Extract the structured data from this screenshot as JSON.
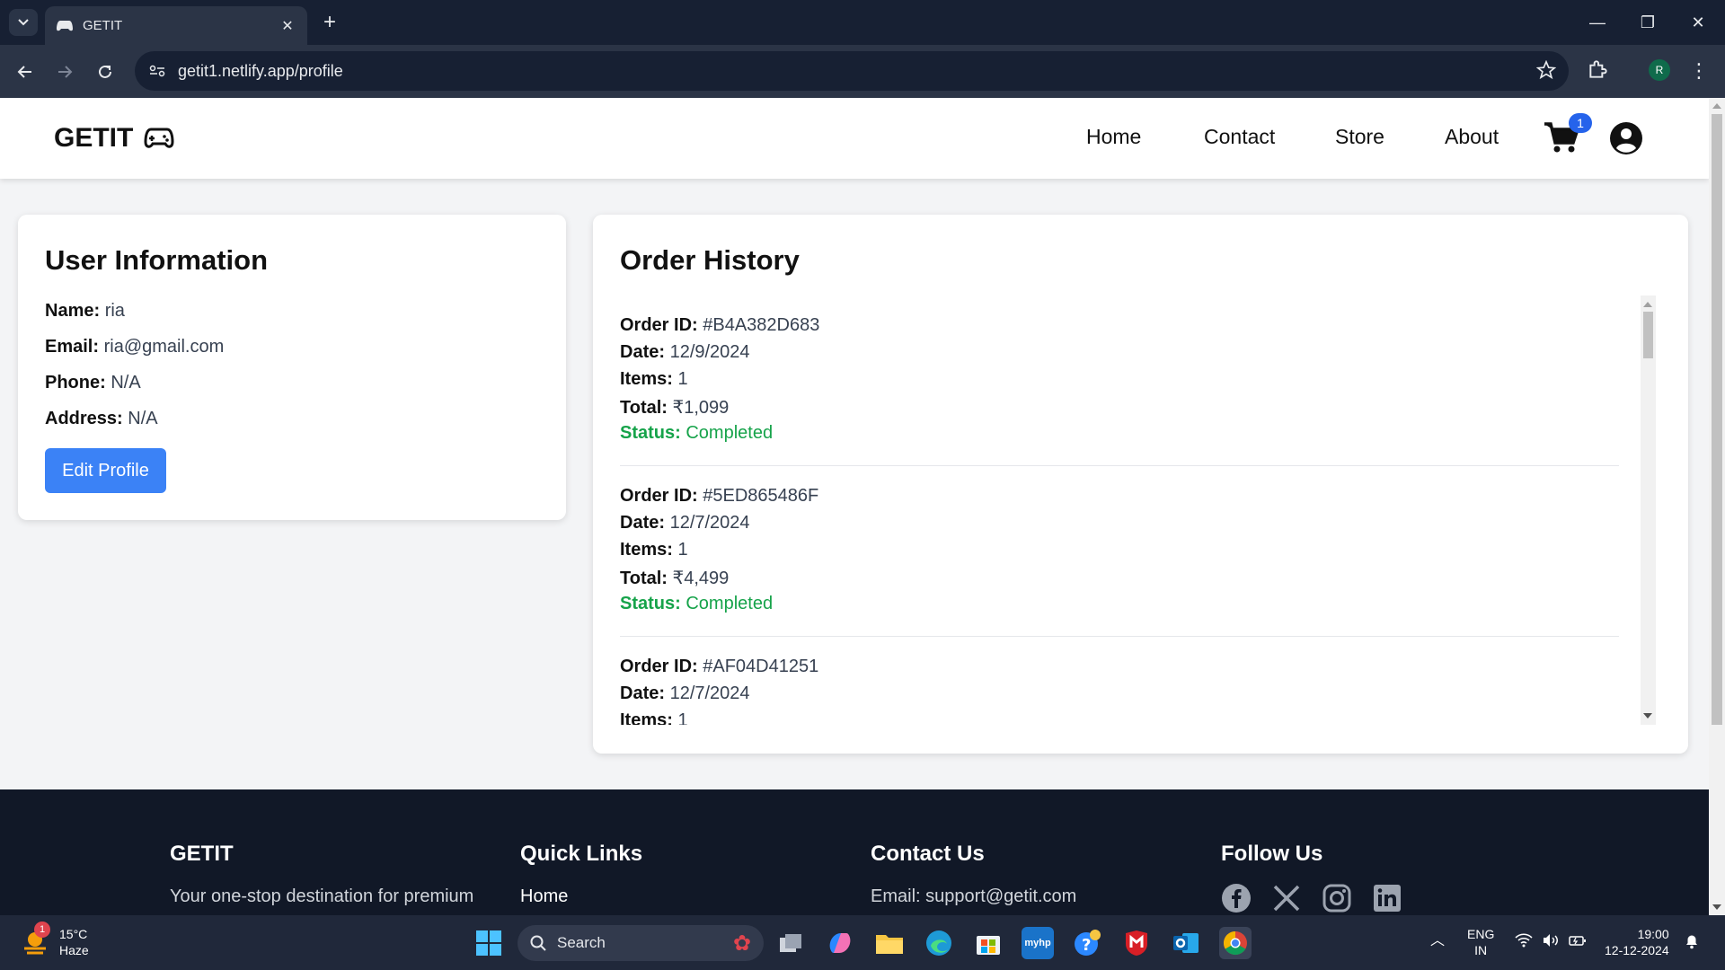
{
  "browser": {
    "tab_title": "GETIT",
    "url": "getit1.netlify.app/profile",
    "profile_initial": "R"
  },
  "site": {
    "brand": "GETIT",
    "nav": [
      "Home",
      "Contact",
      "Store",
      "About"
    ],
    "cart_count": "1"
  },
  "user_info": {
    "heading": "User Information",
    "fields": [
      {
        "label": "Name:",
        "value": "ria"
      },
      {
        "label": "Email:",
        "value": "ria@gmail.com"
      },
      {
        "label": "Phone:",
        "value": "N/A"
      },
      {
        "label": "Address:",
        "value": "N/A"
      }
    ],
    "edit_label": "Edit Profile"
  },
  "orders": {
    "heading": "Order History",
    "labels": {
      "id": "Order ID:",
      "date": "Date:",
      "items": "Items:",
      "total": "Total:",
      "status": "Status:"
    },
    "list": [
      {
        "id": "#B4A382D683",
        "date": "12/9/2024",
        "items": "1",
        "total": "₹1,099",
        "status": "Completed"
      },
      {
        "id": "#5ED865486F",
        "date": "12/7/2024",
        "items": "1",
        "total": "₹4,499",
        "status": "Completed"
      },
      {
        "id": "#AF04D41251",
        "date": "12/7/2024",
        "items": "1",
        "total": "",
        "status": ""
      }
    ]
  },
  "footer": {
    "brand": "GETIT",
    "tagline": "Your one-stop destination for premium",
    "quick_links_heading": "Quick Links",
    "quick_links": [
      "Home"
    ],
    "contact_heading": "Contact Us",
    "contact_email": "Email: support@getit.com",
    "follow_heading": "Follow Us",
    "socials": [
      "facebook-icon",
      "x-icon",
      "instagram-icon",
      "linkedin-icon"
    ]
  },
  "taskbar": {
    "weather_temp": "15°C",
    "weather_desc": "Haze",
    "weather_badge": "1",
    "search_label": "Search",
    "lang_top": "ENG",
    "lang_bottom": "IN",
    "time": "19:00",
    "date": "12-12-2024"
  },
  "colors": {
    "accent_blue": "#3b82f6",
    "status_green": "#16a34a",
    "footer_bg": "#111827"
  }
}
